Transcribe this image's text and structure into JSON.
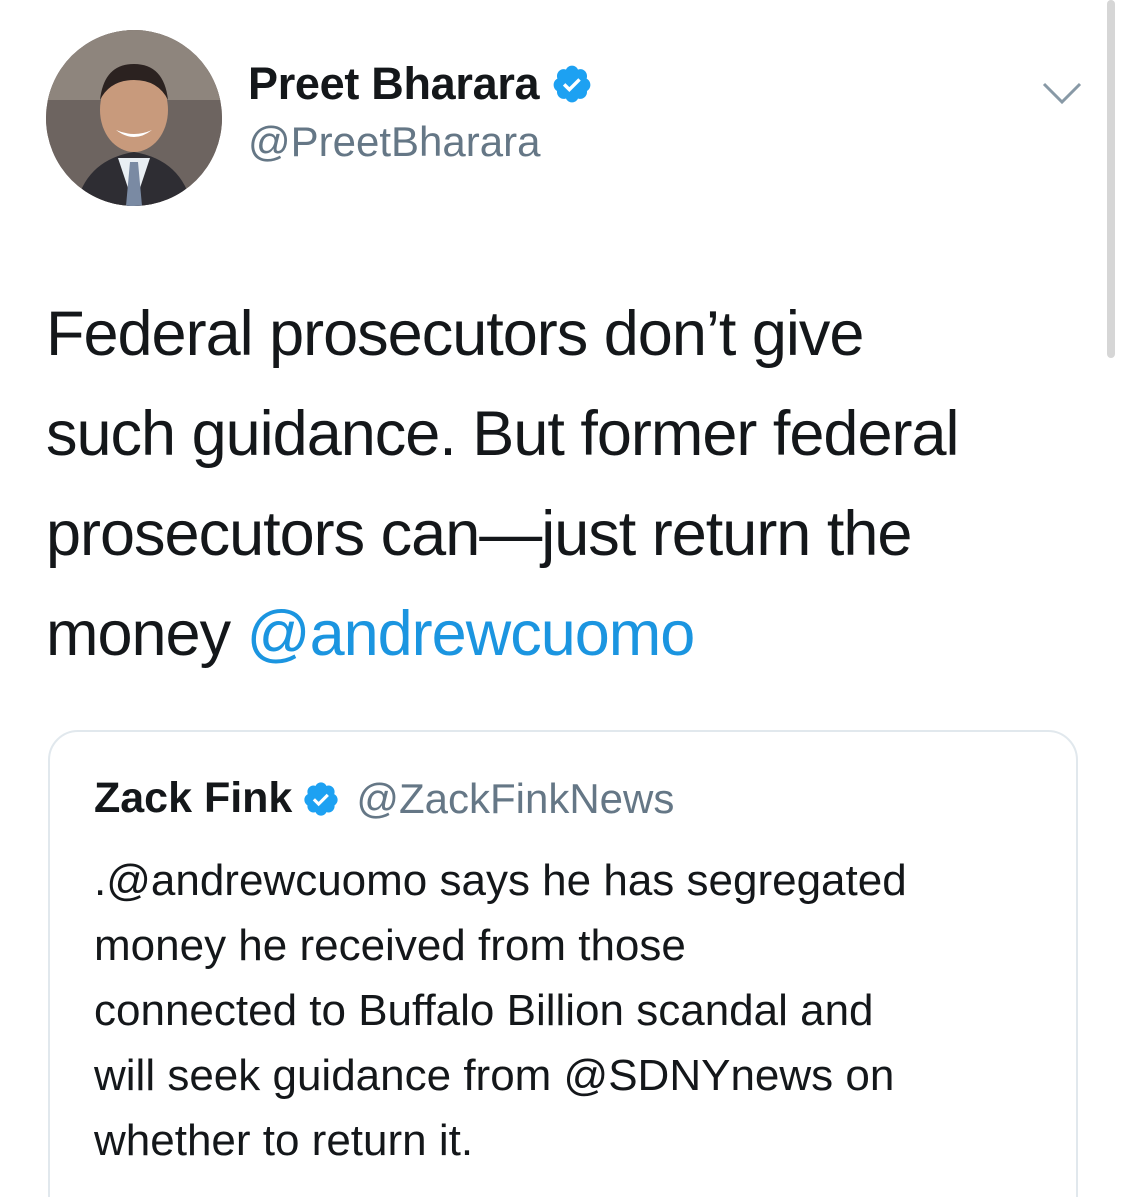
{
  "author": {
    "display_name": "Preet Bharara",
    "handle": "@PreetBharara",
    "verified": true
  },
  "tweet": {
    "lines": [
      "Federal prosecutors don’t give",
      "such guidance. But former federal",
      "prosecutors can—just return the"
    ],
    "last_line_text": "money ",
    "mention": "@andrewcuomo"
  },
  "quoted_tweet": {
    "display_name": "Zack Fink",
    "handle": "@ZackFinkNews",
    "verified": true,
    "lines": [
      ".@andrewcuomo says he has segregated",
      "money he received from those",
      "connected to Buffalo Billion scandal and",
      "will seek guidance from @SDNYnews on",
      "whether to return it."
    ]
  },
  "icons": {
    "verified": "verified-badge-icon",
    "menu": "chevron-down-icon"
  },
  "colors": {
    "link": "#1b95e0",
    "secondary_text": "#657786",
    "card_border": "#e1e8ed",
    "verified_blue": "#1da1f2"
  }
}
